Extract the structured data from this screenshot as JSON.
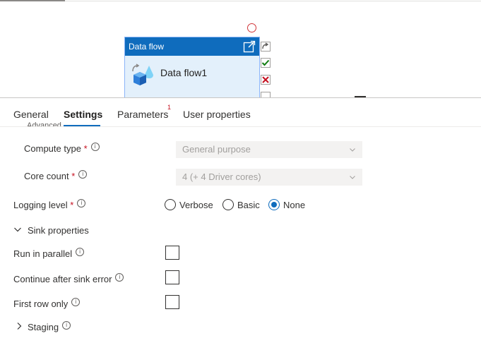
{
  "canvas": {
    "activity_header": "Data flow",
    "activity_name": "Data flow1"
  },
  "tabs": [
    {
      "label": "General"
    },
    {
      "label": "Settings"
    },
    {
      "label": "Parameters",
      "badge": "1"
    },
    {
      "label": "User properties"
    }
  ],
  "settings": {
    "cut_off_label": "Advanced",
    "compute_type": {
      "label": "Compute type",
      "required": "*",
      "value": "General purpose"
    },
    "core_count": {
      "label": "Core count",
      "required": "*",
      "value": "4 (+ 4 Driver cores)"
    },
    "logging_level": {
      "label": "Logging level",
      "required": "*",
      "options": [
        "Verbose",
        "Basic",
        "None"
      ],
      "selected": "None"
    },
    "sink_section": "Sink properties",
    "run_in_parallel": {
      "label": "Run in parallel",
      "checked": false
    },
    "continue_after_error": {
      "label": "Continue after sink error",
      "checked": false
    },
    "first_row_only": {
      "label": "First row only",
      "checked": false
    },
    "staging_section": "Staging"
  },
  "colors": {
    "accent": "#0f6cbd",
    "required": "#c50f1f",
    "error": "#d13438",
    "success": "#107c10"
  },
  "icons": [
    "open-external-icon",
    "data-flow-icon",
    "redo-icon",
    "check-icon",
    "close-icon",
    "info-icon",
    "chevron-down-icon",
    "chevron-right-icon"
  ]
}
